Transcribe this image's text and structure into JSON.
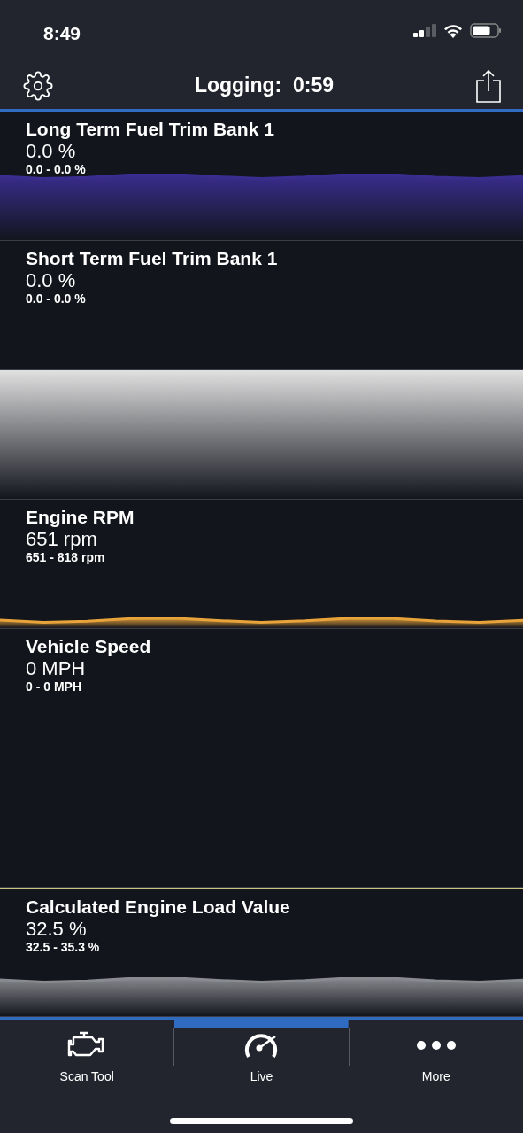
{
  "status_bar": {
    "time": "8:49"
  },
  "header": {
    "title": "Logging:  0:59"
  },
  "panels": [
    {
      "kind": "gauge",
      "title": "Long Term Fuel Trim Bank 1",
      "value": "0.0 %",
      "range": "0.0 - 0.0 %",
      "color": "#3a2d8f",
      "outlined": false
    },
    {
      "kind": "gauge",
      "title": "Short Term Fuel Trim Bank 1",
      "value": "0.0 %",
      "range": "0.0 - 0.0 %",
      "outlined": false
    },
    {
      "kind": "empty",
      "color": "#e2e2e2",
      "outlined": false
    },
    {
      "kind": "gauge",
      "title": "Engine RPM",
      "value": "651 rpm",
      "range": "651 - 818 rpm",
      "color": "#e8a33a",
      "outlined": false
    },
    {
      "kind": "gauge",
      "title": "Vehicle Speed",
      "value": "0 MPH",
      "range": "0 - 0 MPH",
      "outlined": false
    },
    {
      "kind": "gauge",
      "title": "Calculated Engine Load Value",
      "value": "32.5 %",
      "range": "32.5 - 35.3 %",
      "color": "#8a8b90",
      "outlined": true
    }
  ],
  "tabs": [
    {
      "label": "Scan Tool",
      "selected": false
    },
    {
      "label": "Live",
      "selected": true
    },
    {
      "label": "More",
      "selected": false
    }
  ]
}
